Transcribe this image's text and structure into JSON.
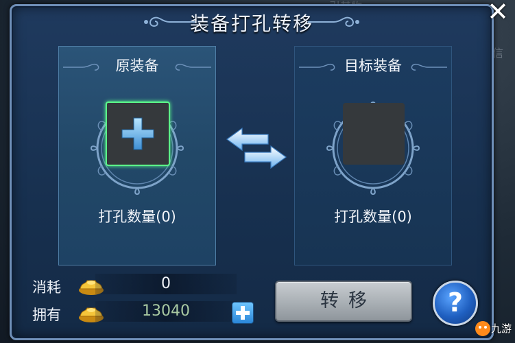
{
  "window": {
    "title": "装备打孔转移",
    "close_label": "✕"
  },
  "background": {
    "faded_texts": [
      "引其物",
      "信"
    ]
  },
  "source_slot": {
    "label": "原装备",
    "hole_count": "打孔数量(0)"
  },
  "target_slot": {
    "label": "目标装备",
    "hole_count": "打孔数量(0)"
  },
  "cost": {
    "consume_label": "消耗",
    "consume_value": "0",
    "own_label": "拥有",
    "own_value": "13040"
  },
  "buttons": {
    "transfer_label": "转移",
    "help_label": "?"
  },
  "watermark": {
    "text": "九游"
  },
  "colors": {
    "panel": "#1f3a5e",
    "slot_highlight": "#5cff8a",
    "owned_value": "#a9c9a2",
    "help_button": "#1f5fc0"
  }
}
